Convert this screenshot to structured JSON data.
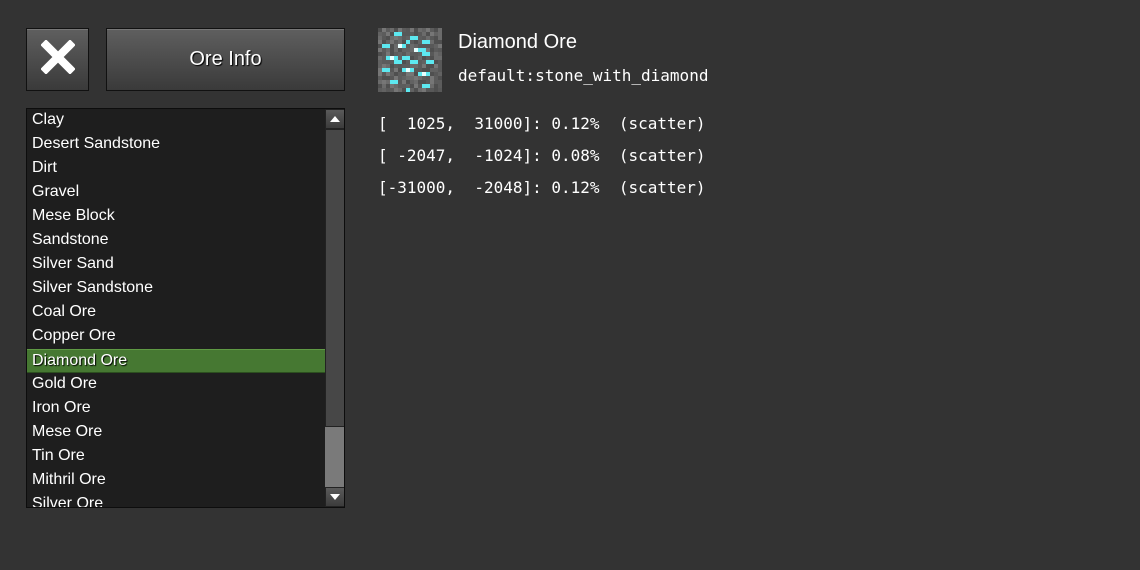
{
  "header": {
    "close_icon": "close-x-icon",
    "title": "Ore Info"
  },
  "ore_list": {
    "items": [
      "Clay",
      "Desert Sandstone",
      "Dirt",
      "Gravel",
      "Mese Block",
      "Sandstone",
      "Silver Sand",
      "Silver Sandstone",
      "Coal Ore",
      "Copper Ore",
      "Diamond Ore",
      "Gold Ore",
      "Iron Ore",
      "Mese Ore",
      "Tin Ore",
      "Mithril Ore",
      "Silver Ore"
    ],
    "selected": "Diamond Ore",
    "selected_color": "#467832"
  },
  "details": {
    "icon": "diamond-ore-texture",
    "name": "Diamond Ore",
    "item_id": "default:stone_with_diamond",
    "ranges": [
      "[  1025,  31000]: 0.12%  (scatter)",
      "[ -2047,  -1024]: 0.08%  (scatter)",
      "[-31000,  -2048]: 0.12%  (scatter)"
    ]
  },
  "colors": {
    "background": "#333333",
    "list_background": "#1e1e1e",
    "scrollbar_track": "#7a7a7a",
    "diamond_cyan": "#5de8f0"
  }
}
